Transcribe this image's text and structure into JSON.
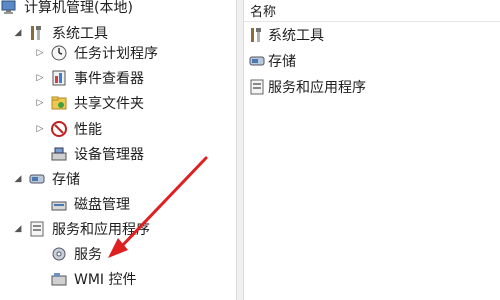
{
  "tree": {
    "root": {
      "label": "计算机管理(本地)",
      "icon": "computer-management-icon"
    },
    "items": [
      {
        "label": "系统工具",
        "icon": "tools-icon",
        "expander": "collapse-arrow"
      },
      {
        "label": "任务计划程序",
        "icon": "clock-icon",
        "expander": "expand-arrow"
      },
      {
        "label": "事件查看器",
        "icon": "event-viewer-icon",
        "expander": "expand-arrow"
      },
      {
        "label": "共享文件夹",
        "icon": "shared-folder-icon",
        "expander": "expand-arrow"
      },
      {
        "label": "性能",
        "icon": "performance-icon",
        "expander": "expand-arrow"
      },
      {
        "label": "设备管理器",
        "icon": "device-manager-icon",
        "expander": "none"
      },
      {
        "label": "存储",
        "icon": "storage-icon",
        "expander": "collapse-arrow"
      },
      {
        "label": "磁盘管理",
        "icon": "disk-management-icon",
        "expander": "none"
      },
      {
        "label": "服务和应用程序",
        "icon": "services-applications-icon",
        "expander": "collapse-arrow"
      },
      {
        "label": "服务",
        "icon": "services-gear-icon",
        "expander": "none"
      },
      {
        "label": "WMI 控件",
        "icon": "wmi-control-icon",
        "expander": "none"
      }
    ]
  },
  "list": {
    "column_header": "名称",
    "items": [
      {
        "label": "系统工具",
        "icon": "tools-icon"
      },
      {
        "label": "存储",
        "icon": "storage-icon"
      },
      {
        "label": "服务和应用程序",
        "icon": "services-applications-icon"
      }
    ]
  },
  "annotation": {
    "type": "red-arrow",
    "color": "#e02020",
    "points_to": "服务"
  },
  "colors": {
    "arrow": "#e02020",
    "splitter": "#f0f0f0",
    "text": "#1e1e1e"
  }
}
